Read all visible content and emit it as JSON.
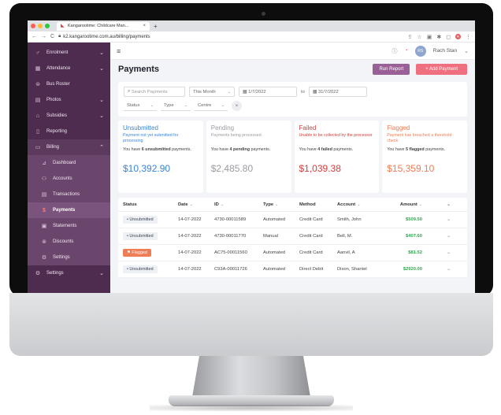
{
  "browser": {
    "tab_title": "Kangarootime: Childcare Man...",
    "tab_close": "×",
    "new_tab": "+",
    "url": "k2.kangarootime.com.au/billing/payments",
    "traffic_colors": [
      "#ff5f57",
      "#febc2e",
      "#28c840"
    ],
    "profile_badge": "R"
  },
  "sidebar": {
    "items": [
      {
        "label": "Enrolment",
        "icon": "user-plus-icon",
        "glyph": "♂",
        "chevron": "⌄"
      },
      {
        "label": "Attendance",
        "icon": "calendar-icon",
        "glyph": "▦",
        "chevron": "⌄"
      },
      {
        "label": "Bus Roster",
        "icon": "bus-icon",
        "glyph": "⊜",
        "chevron": ""
      },
      {
        "label": "Photos",
        "icon": "photo-icon",
        "glyph": "▤",
        "chevron": "⌄"
      },
      {
        "label": "Subsidies",
        "icon": "bank-icon",
        "glyph": "⌂",
        "chevron": "⌄"
      },
      {
        "label": "Reporting",
        "icon": "report-icon",
        "glyph": "▯",
        "chevron": ""
      },
      {
        "label": "Billing",
        "icon": "billing-icon",
        "glyph": "▭",
        "chevron": "⌃"
      }
    ],
    "billing_sub": [
      {
        "label": "Dashboard",
        "icon": "chart-icon",
        "glyph": "⊿"
      },
      {
        "label": "Accounts",
        "icon": "accounts-icon",
        "glyph": "⚇"
      },
      {
        "label": "Transactions",
        "icon": "transactions-icon",
        "glyph": "▤"
      },
      {
        "label": "Payments",
        "icon": "payments-icon",
        "glyph": "$"
      },
      {
        "label": "Statements",
        "icon": "statements-icon",
        "glyph": "▣"
      },
      {
        "label": "Discounts",
        "icon": "discount-icon",
        "glyph": "⊗"
      },
      {
        "label": "Settings",
        "icon": "gear-icon",
        "glyph": "⚙"
      }
    ],
    "settings": {
      "label": "Settings",
      "glyph": "⚙",
      "chevron": "⌄"
    }
  },
  "topbar": {
    "user_initials": "RS",
    "user_name": "Rach Stan",
    "menu_glyph": "≡"
  },
  "page": {
    "title": "Payments",
    "run_report": "Run Report",
    "add_payment": "+ Add Payment"
  },
  "filters": {
    "search_placeholder": "Search Payments",
    "period": "This Month",
    "start_date": "1/7/2022",
    "to": "to",
    "end_date": "31/7/2022",
    "status": "Status",
    "type": "Type",
    "centre": "Centre",
    "clear": "×"
  },
  "cards": [
    {
      "title": "Unsubmitted",
      "subtitle": "Payment not yet submitted for processing",
      "count_pre": "You have ",
      "count": "6 unsubmitted",
      "count_post": " payments.",
      "amount": "$10,392.90",
      "color": "#3a84d6"
    },
    {
      "title": "Pending",
      "subtitle": "Payments being processed",
      "count_pre": "You have ",
      "count": "4 pending",
      "count_post": " payments.",
      "amount": "$2,485.80",
      "color": "#9a9aa2"
    },
    {
      "title": "Failed",
      "subtitle": "Unable to be collected by the processor",
      "count_pre": "You have ",
      "count": "4 failed",
      "count_post": " payments.",
      "amount": "$1,039.38",
      "color": "#d43b3b"
    },
    {
      "title": "Flagged",
      "subtitle": "Payment has breached a threshold check",
      "count_pre": "You have ",
      "count": "5 flagged",
      "count_post": " payments.",
      "amount": "$15,359.10",
      "color": "#f07b52"
    }
  ],
  "table": {
    "headers": {
      "status": "Status",
      "date": "Date",
      "id": "ID",
      "type": "Type",
      "method": "Method",
      "account": "Account",
      "amount": "Amount",
      "sort": "⌄",
      "expand": "⌄"
    },
    "rows": [
      {
        "status": "• Unsubmitted",
        "flagged": false,
        "date": "14-07-2022",
        "id": "4730-00011589",
        "type": "Automated",
        "method": "Credit Card",
        "account": "Smith, John",
        "amount": "$509.50"
      },
      {
        "status": "• Unsubmitted",
        "flagged": false,
        "date": "14-07-2022",
        "id": "4730-00011770",
        "type": "Manual",
        "method": "Credit Card",
        "account": "Bell, M.",
        "amount": "$407.60"
      },
      {
        "status": "⚑ Flagged",
        "flagged": true,
        "date": "14-07-2022",
        "id": "AC75-00011560",
        "type": "Automated",
        "method": "Credit Card",
        "account": "Aanvil, A",
        "amount": "$81.52"
      },
      {
        "status": "• Unsubmitted",
        "flagged": false,
        "date": "14-07-2022",
        "id": "C93A-00011726",
        "type": "Automated",
        "method": "Direct Debit",
        "account": "Dixon, Shantel",
        "amount": "$2920.00"
      }
    ]
  }
}
